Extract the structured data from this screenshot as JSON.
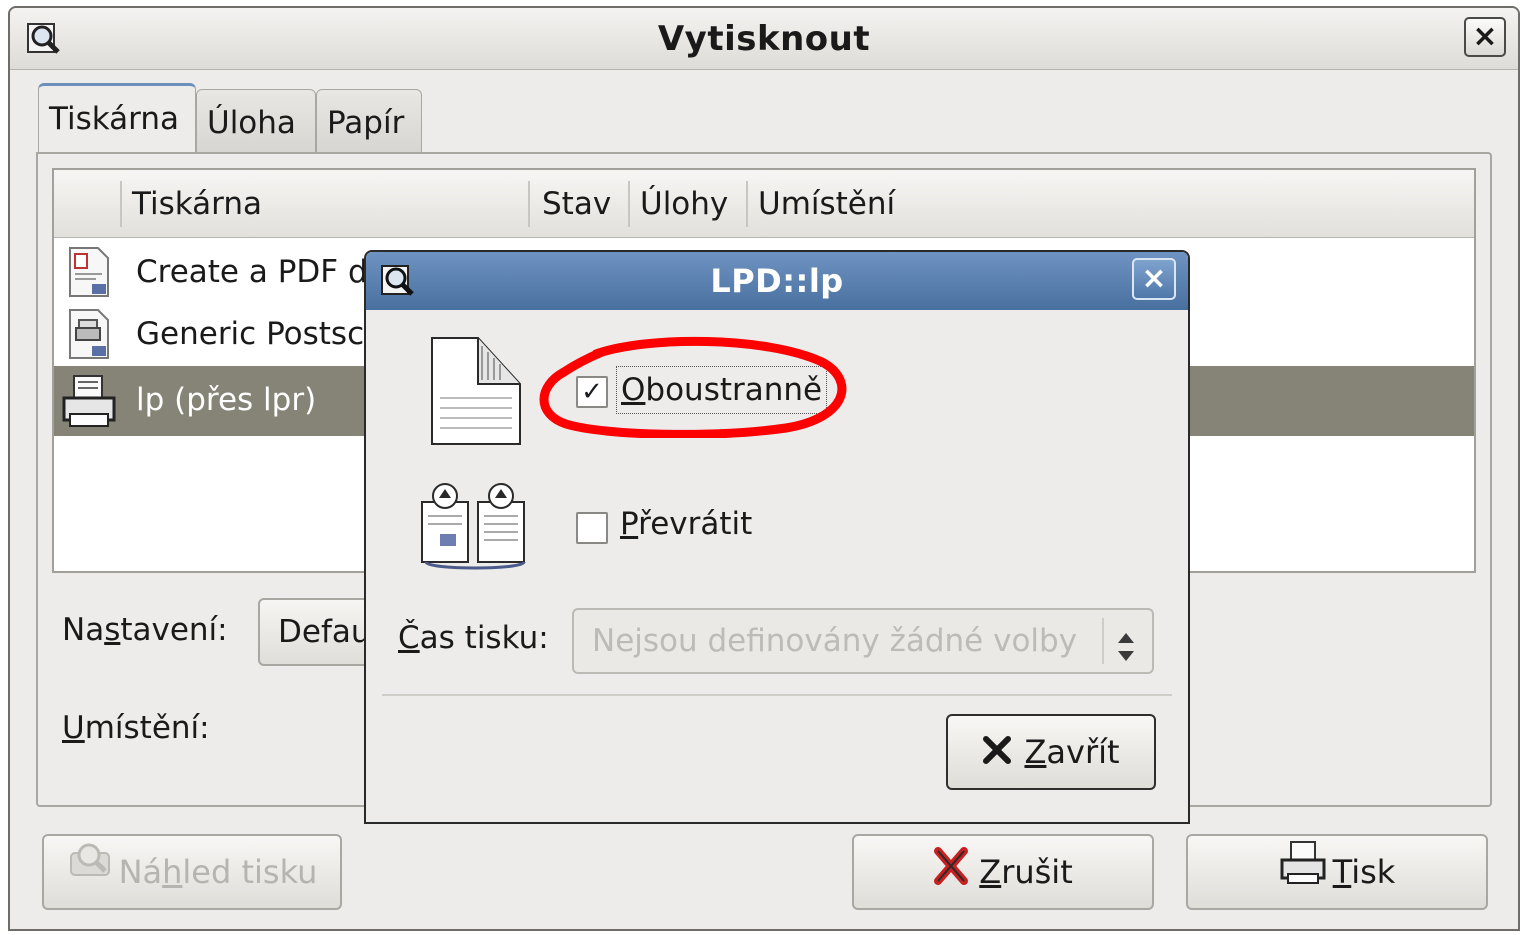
{
  "main_window": {
    "title": "Vytisknout",
    "close_glyph": "×"
  },
  "tabs": [
    {
      "label": "Tiskárna",
      "active": true
    },
    {
      "label": "Úloha",
      "active": false
    },
    {
      "label": "Papír",
      "active": false
    }
  ],
  "printer_table": {
    "columns": [
      "Tiskárna",
      "Stav",
      "Úlohy",
      "Umístění"
    ],
    "rows": [
      {
        "name": "Create a PDF d",
        "icon": "pdf-document-icon",
        "selected": false
      },
      {
        "name": "Generic Postsc",
        "icon": "postscript-document-icon",
        "selected": false
      },
      {
        "name": "lp (přes lpr)",
        "icon": "printer-icon",
        "selected": true
      }
    ]
  },
  "settings": {
    "nastaveni_label_pre": "Na",
    "nastaveni_label_mn": "s",
    "nastaveni_label_post": "tavení:",
    "nastaveni_value": "Defau",
    "umisteni_label_mn": "U",
    "umisteni_label_post": "místění:"
  },
  "bottom_buttons": {
    "preview_pre": "Ná",
    "preview_mn": "h",
    "preview_post": "led tisku",
    "cancel_mn": "Z",
    "cancel_post": "rušit",
    "print_mn": "T",
    "print_post": "isk"
  },
  "dialog": {
    "title": "LPD::lp",
    "close_glyph": "×",
    "duplex_mn": "O",
    "duplex_post": "boustranně",
    "duplex_checked": true,
    "tumble_mn": "P",
    "tumble_post": "řevrátit",
    "tumble_checked": false,
    "print_time_mn": "Č",
    "print_time_post": "as tisku:",
    "print_time_value": "Nejsou definovány žádné volby",
    "close_button_mn": "Z",
    "close_button_post": "avřít",
    "check_glyph": "✓"
  },
  "colors": {
    "selection": "#868476",
    "dialog_titlebar": "#5b82b2",
    "annotation_circle": "#ff0000"
  }
}
